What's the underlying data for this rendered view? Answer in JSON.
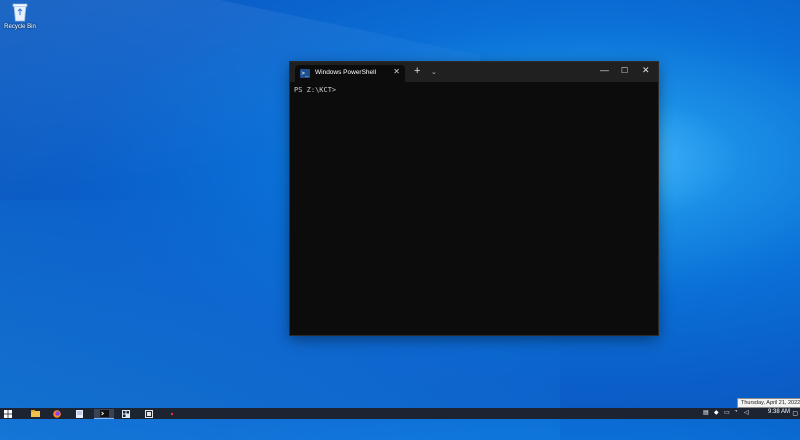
{
  "desktop": {
    "recycle_bin_label": "Recycle Bin"
  },
  "terminal": {
    "tab_title": "Windows PowerShell",
    "tab_close": "✕",
    "new_tab": "+",
    "dropdown": "⌄",
    "minimize": "—",
    "maximize": "☐",
    "close": "✕",
    "prompt": "PS Z:\\KCT>"
  },
  "tooltip": {
    "date": "Thursday, April 21, 2022"
  },
  "taskbar": {
    "time": "9:38 AM",
    "icons": [
      "windows-start-icon",
      "file-explorer-icon",
      "firefox-icon",
      "notepad-icon",
      "terminal-icon",
      "app-icon",
      "app2-icon",
      "red-app-icon"
    ]
  },
  "colors": {
    "taskbar": "#1c2331",
    "terminal_bg": "#0c0c0c",
    "titlebar": "#202020"
  }
}
